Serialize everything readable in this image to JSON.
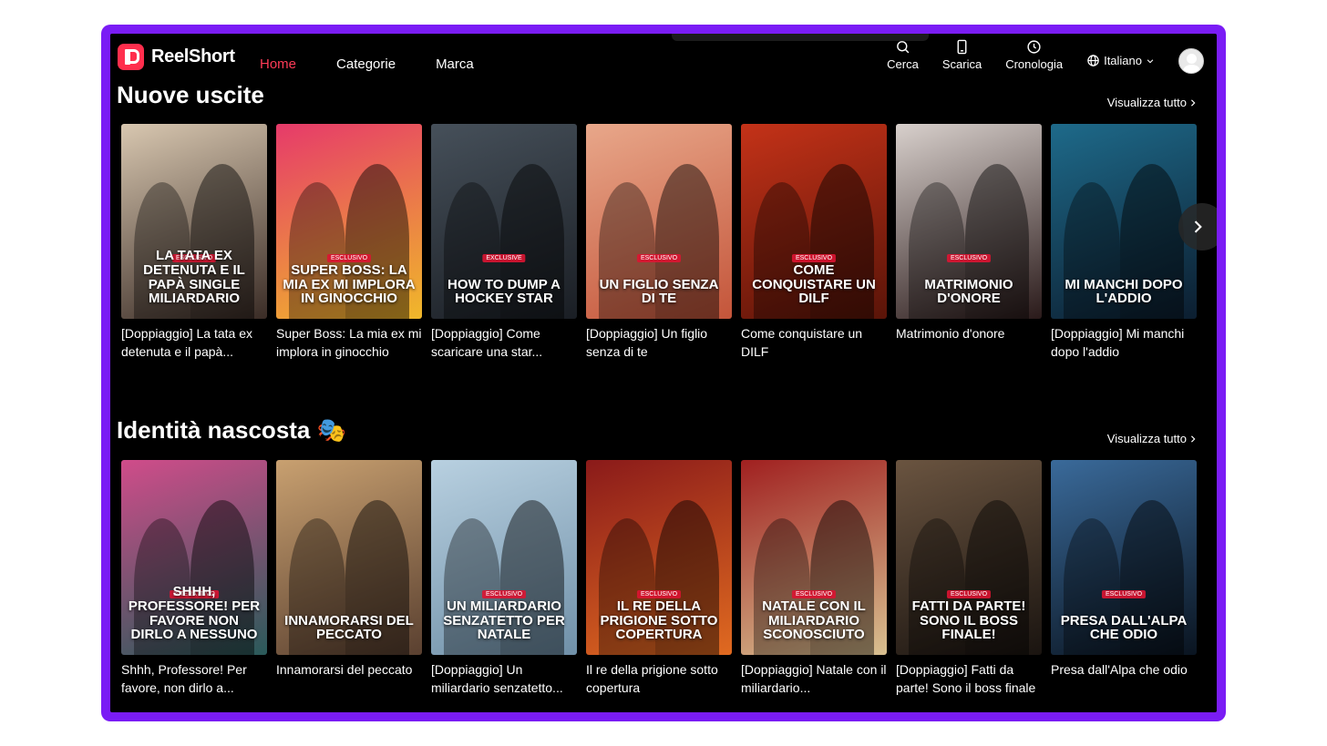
{
  "brand": {
    "name": "ReelShort",
    "accent": "#ff2e4d",
    "frame": "#7a1cf5"
  },
  "nav": [
    {
      "label": "Home",
      "active": true
    },
    {
      "label": "Categorie",
      "active": false
    },
    {
      "label": "Marca",
      "active": false
    }
  ],
  "tools": {
    "search": "Cerca",
    "download": "Scarica",
    "history": "Cronologia",
    "language": "Italiano"
  },
  "sections": [
    {
      "title": "Nuove uscite",
      "view_all": "Visualizza tutto",
      "cards": [
        {
          "caption": "[Doppiaggio] La tata ex detenuta e il papà...",
          "poster_text": "La tata ex detenuta e il papà single Miliardario",
          "badge": "ESCLUSIVO",
          "colors": [
            "#d8c7b0",
            "#3a2c26"
          ]
        },
        {
          "caption": "Super Boss: La mia ex mi implora in ginocchio",
          "poster_text": "SUPER BOSS: LA MIA EX MI IMPLORA IN GINOCCHIO",
          "badge": "ESCLUSIVO",
          "colors": [
            "#e63a6a",
            "#f0b82a"
          ]
        },
        {
          "caption": "[Doppiaggio] Come scaricare una star...",
          "poster_text": "HOW TO DUMP A HOCKEY STAR",
          "badge": "EXCLUSIVE",
          "colors": [
            "#46505a",
            "#1a1e24"
          ]
        },
        {
          "caption": "[Doppiaggio] Un figlio senza di te",
          "poster_text": "UN FIGLIO Senza DI TE",
          "badge": "ESCLUSIVO",
          "colors": [
            "#e8a78a",
            "#c4553a"
          ]
        },
        {
          "caption": "Come conquistare un DILF",
          "poster_text": "COME CONQUISTARE UN DILF",
          "badge": "ESCLUSIVO",
          "colors": [
            "#c43218",
            "#5a1408"
          ]
        },
        {
          "caption": "Matrimonio d'onore",
          "poster_text": "Matrimonio D'onore",
          "badge": "ESCLUSIVO",
          "colors": [
            "#d8d0cc",
            "#2a1a1a"
          ]
        },
        {
          "caption": "[Doppiaggio] Mi manchi dopo l'addio",
          "poster_text": "Mi manchi DOPO L'ADDIO",
          "badge": "",
          "colors": [
            "#1e6a8a",
            "#0c1e30"
          ]
        }
      ]
    },
    {
      "title": "Identità nascosta 🎭",
      "view_all": "Visualizza tutto",
      "cards": [
        {
          "caption": "Shhh, Professore! Per favore, non dirlo a...",
          "poster_text": "SHHH, PROFESSORE! PER FAVORE Non dirlo a nessuno",
          "badge": "INTERATTIVO",
          "colors": [
            "#d04c8a",
            "#2a5a5a"
          ]
        },
        {
          "caption": "Innamorarsi del peccato",
          "poster_text": "INNAMORARSI DEL PECCATO",
          "badge": "",
          "colors": [
            "#c8a070",
            "#5a4030"
          ]
        },
        {
          "caption": "[Doppiaggio] Un miliardario senzatetto...",
          "poster_text": "UN MILIARDARIO SENZATETTO per Natale",
          "badge": "ESCLUSIVO",
          "colors": [
            "#b8d0e0",
            "#7090a8"
          ]
        },
        {
          "caption": "Il re della prigione sotto copertura",
          "poster_text": "IL RE DELLA PRIGIONE SOTTO COPERTURA",
          "badge": "ESCLUSIVO",
          "colors": [
            "#8a1a1a",
            "#e06a20"
          ]
        },
        {
          "caption": "[Doppiaggio] Natale con il miliardario...",
          "poster_text": "NATALE CON IL MILIARDARIO SCONOSCIUTO",
          "badge": "ESCLUSIVO",
          "colors": [
            "#a02020",
            "#d8c090"
          ]
        },
        {
          "caption": "[Doppiaggio] Fatti da parte! Sono il boss finale",
          "poster_text": "FATTI DA PARTE! SONO IL BOSS Finale!",
          "badge": "ESCLUSIVO",
          "colors": [
            "#6a5440",
            "#1a1410"
          ]
        },
        {
          "caption": "Presa dall'Alpa che odio",
          "poster_text": "PRESA DALL'ALPA CHE ODIO",
          "badge": "ESCLUSIVO",
          "colors": [
            "#3a6a9a",
            "#0a1420"
          ]
        }
      ]
    }
  ]
}
